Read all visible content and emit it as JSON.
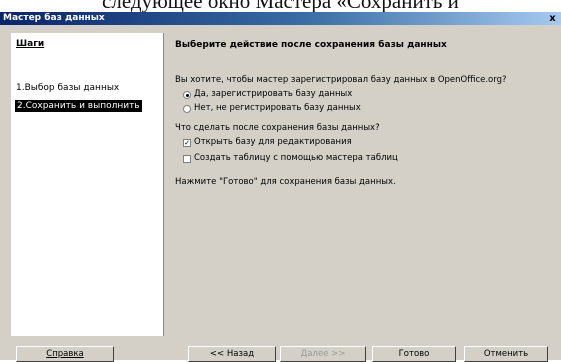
{
  "document": {
    "heading_fragment": "следующее окно Мастера «Сохранить и"
  },
  "window": {
    "title": "Мастер баз данных",
    "close": "x"
  },
  "sidebar": {
    "heading": "Шаги",
    "steps": [
      {
        "label": "1.Выбор базы данных"
      },
      {
        "label": "2.Сохранить и выполнить"
      }
    ]
  },
  "content": {
    "heading": "Выберите действие после сохранения базы данных",
    "question1": "Вы хотите, чтобы мастер зарегистрировал базу данных в OpenOffice.org?",
    "radio_yes": "Да, зарегистрировать базу данных",
    "radio_no": "Нет, не регистрировать базу данных",
    "question2": "Что сделать после сохранения базы данных?",
    "check_open": "Открыть базу для редактирования",
    "check_create": "Создать таблицу с помощью мастера таблиц",
    "finish_note": "Нажмите \"Готово\" для сохранения базы данных."
  },
  "buttons": {
    "help": "Справка",
    "back": "<< Назад",
    "next": "Далее >>",
    "finish": "Готово",
    "cancel": "Отменить"
  }
}
